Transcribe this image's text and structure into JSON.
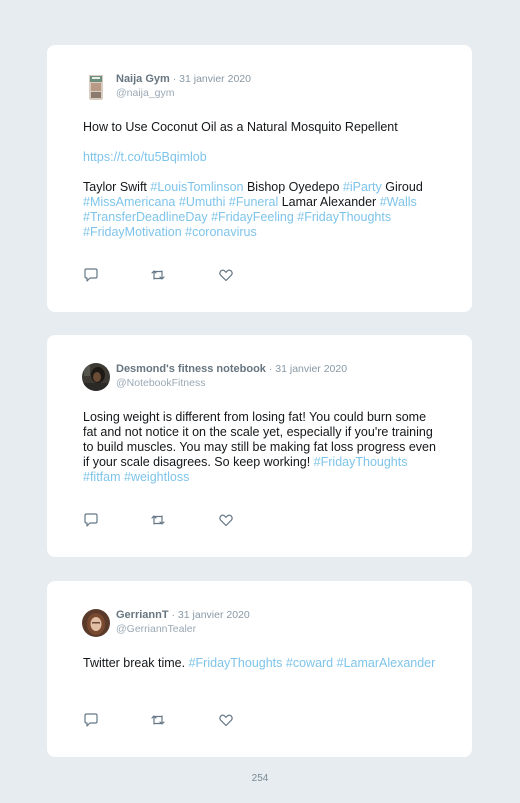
{
  "tweets": [
    {
      "name": "Naija Gym",
      "separator": " · ",
      "date": "31 janvier 2020",
      "handle": "@naija_gym",
      "text1": "How to Use Coconut Oil as a Natural Mosquito Repellent",
      "link": "https://t.co/tu5Bqimlob",
      "segments": [
        {
          "t": "Taylor Swift ",
          "tag": false
        },
        {
          "t": "#LouisTomlinson",
          "tag": true
        },
        {
          "t": " Bishop Oyedepo ",
          "tag": false
        },
        {
          "t": "#iParty",
          "tag": true
        },
        {
          "t": " Giroud ",
          "tag": false
        },
        {
          "t": "#MissAmericana",
          "tag": true
        },
        {
          "t": " ",
          "tag": false
        },
        {
          "t": "#Umuthi",
          "tag": true
        },
        {
          "t": " ",
          "tag": false
        },
        {
          "t": "#Funeral",
          "tag": true
        },
        {
          "t": " Lamar Alexander ",
          "tag": false
        },
        {
          "t": "#Walls",
          "tag": true
        },
        {
          "t": " ",
          "tag": false
        },
        {
          "t": "#TransferDeadlineDay",
          "tag": true
        },
        {
          "t": " ",
          "tag": false
        },
        {
          "t": "#FridayFeeling",
          "tag": true
        },
        {
          "t": " ",
          "tag": false
        },
        {
          "t": "#FridayThoughts",
          "tag": true
        },
        {
          "t": " ",
          "tag": false
        },
        {
          "t": "#FridayMotivation",
          "tag": true
        },
        {
          "t": " ",
          "tag": false
        },
        {
          "t": "#coronavirus",
          "tag": true
        }
      ]
    },
    {
      "name": "Desmond's fitness notebook",
      "separator": " · ",
      "date": "31 janvier 2020",
      "handle": "@NotebookFitness",
      "segments": [
        {
          "t": "Losing weight is different from losing fat! You could burn some fat and not notice it on the scale yet, especially if you're training to build muscles. You may still be making fat loss progress even if your scale disagrees. So keep working! ",
          "tag": false
        },
        {
          "t": "#FridayThoughts",
          "tag": true
        },
        {
          "t": " ",
          "tag": false
        },
        {
          "t": "#fitfam",
          "tag": true
        },
        {
          "t": " ",
          "tag": false
        },
        {
          "t": "#weightloss",
          "tag": true
        }
      ]
    },
    {
      "name": "GerriannT",
      "separator": " · ",
      "date": "31 janvier 2020",
      "handle": "@GerriannTealer",
      "segments": [
        {
          "t": "Twitter break time. ",
          "tag": false
        },
        {
          "t": "#FridayThoughts",
          "tag": true
        },
        {
          "t": " ",
          "tag": false
        },
        {
          "t": "#coward",
          "tag": true
        },
        {
          "t": " ",
          "tag": false
        },
        {
          "t": "#LamarAlexander",
          "tag": true
        }
      ]
    }
  ],
  "action_icons": [
    "reply-icon",
    "retweet-icon",
    "like-icon"
  ],
  "page_number": "254"
}
